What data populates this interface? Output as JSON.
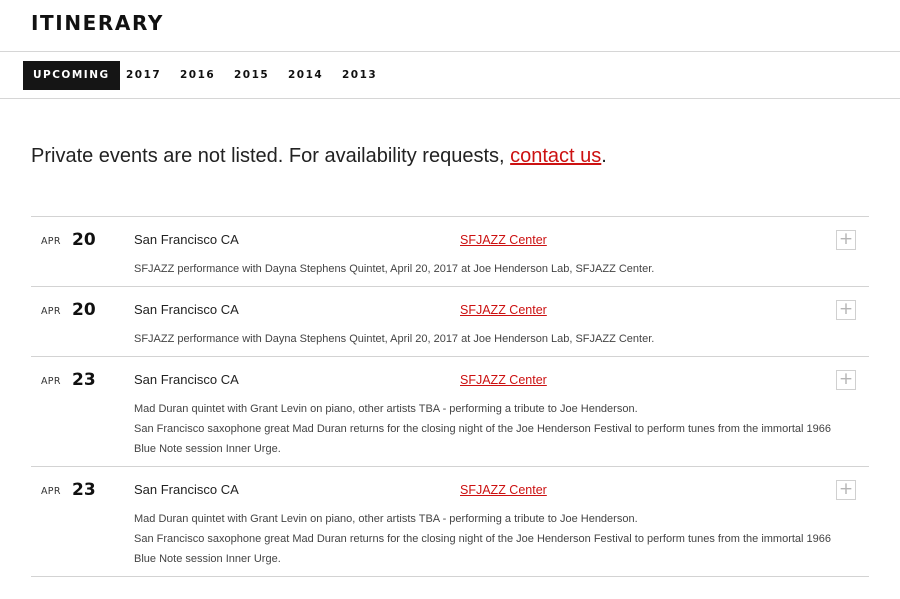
{
  "header": {
    "title": "ITINERARY"
  },
  "tabs": [
    {
      "label": "UPCOMING",
      "active": true
    },
    {
      "label": "2017"
    },
    {
      "label": "2016"
    },
    {
      "label": "2015"
    },
    {
      "label": "2014"
    },
    {
      "label": "2013"
    }
  ],
  "intro": {
    "text": "Private events are not listed. For availability requests, ",
    "link": "contact us",
    "suffix": "."
  },
  "events": [
    {
      "month": "APR",
      "day": "20",
      "city": "San Francisco CA",
      "venue": "SFJAZZ Center",
      "desc": [
        "SFJAZZ performance with Dayna Stephens Quintet, April 20, 2017 at Joe Henderson Lab, SFJAZZ Center."
      ],
      "toggle": "+"
    },
    {
      "month": "APR",
      "day": "20",
      "city": "San Francisco CA",
      "venue": "SFJAZZ Center",
      "desc": [
        "SFJAZZ performance with Dayna Stephens Quintet, April 20, 2017 at Joe Henderson Lab, SFJAZZ Center."
      ],
      "toggle": "+"
    },
    {
      "month": "APR",
      "day": "23",
      "city": "San Francisco CA",
      "venue": "SFJAZZ Center",
      "desc": [
        "Mad Duran quintet with Grant Levin on piano, other artists TBA - performing a tribute to Joe Henderson.",
        "San Francisco saxophone great Mad Duran returns for the closing night of the Joe Henderson Festival to perform tunes from the immortal 1966 Blue Note session Inner Urge."
      ],
      "toggle": "+"
    },
    {
      "month": "APR",
      "day": "23",
      "city": "San Francisco CA",
      "venue": "SFJAZZ Center",
      "desc": [
        "Mad Duran quintet with Grant Levin on piano, other artists TBA - performing a tribute to Joe Henderson.",
        "San Francisco saxophone great Mad Duran returns for the closing night of the Joe Henderson Festival to perform tunes from the immortal 1966 Blue Note session Inner Urge."
      ],
      "toggle": "+"
    }
  ]
}
